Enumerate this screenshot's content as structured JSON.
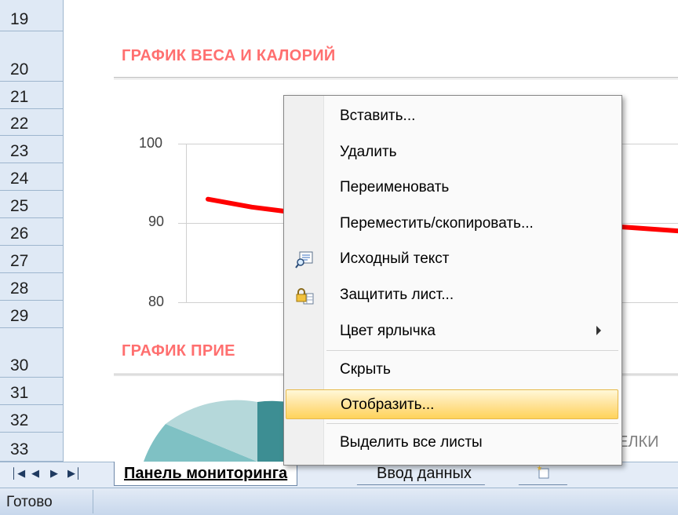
{
  "rows": [
    "19",
    "20",
    "21",
    "22",
    "23",
    "24",
    "25",
    "26",
    "27",
    "28",
    "29",
    "30",
    "31",
    "32",
    "33"
  ],
  "sheet": {
    "chart1_title": "ГРАФИК ВЕСА И КАЛОРИЙ",
    "chart2_title": "ГРАФИК ПРИЕ",
    "right_partial_label": "ЕЛКИ"
  },
  "chart_data": {
    "type": "line",
    "title": "ГРАФИК ВЕСА И КАЛОРИЙ",
    "y_ticks": [
      "100",
      "90",
      "80"
    ],
    "ylim": [
      80,
      100
    ],
    "series": [
      {
        "color": "#ff0000",
        "x": [
          1,
          2,
          3
        ],
        "values": [
          93,
          92,
          91.5
        ]
      },
      {
        "color": "#ff0000",
        "x": [
          4,
          5
        ],
        "values": [
          89.5,
          89
        ]
      }
    ],
    "grid": true
  },
  "pie_colors": [
    "#3d8e93",
    "#7fc1c4",
    "#b5d8da"
  ],
  "context_menu": {
    "items": [
      {
        "label": "Вставить...",
        "icon": ""
      },
      {
        "label": "Удалить",
        "icon": ""
      },
      {
        "label": "Переименовать",
        "icon": ""
      },
      {
        "label": "Переместить/скопировать...",
        "icon": ""
      },
      {
        "label": "Исходный текст",
        "icon": "view-code-icon"
      },
      {
        "label": "Защитить лист...",
        "icon": "protect-sheet-icon"
      },
      {
        "label": "Цвет ярлычка",
        "icon": "",
        "submenu": true
      },
      {
        "label": "Скрыть",
        "icon": ""
      },
      {
        "label": "Отобразить...",
        "icon": "",
        "highlighted": true
      },
      {
        "label": "Выделить все листы",
        "icon": ""
      }
    ]
  },
  "tabs": {
    "active": "Панель мониторинга",
    "second": "Ввод данных"
  },
  "status": {
    "text": "Готово"
  },
  "colors": {
    "title_accent": "#ff6f6f",
    "menu_highlight": "#ffd35a",
    "chart_line": "#ff0000"
  }
}
